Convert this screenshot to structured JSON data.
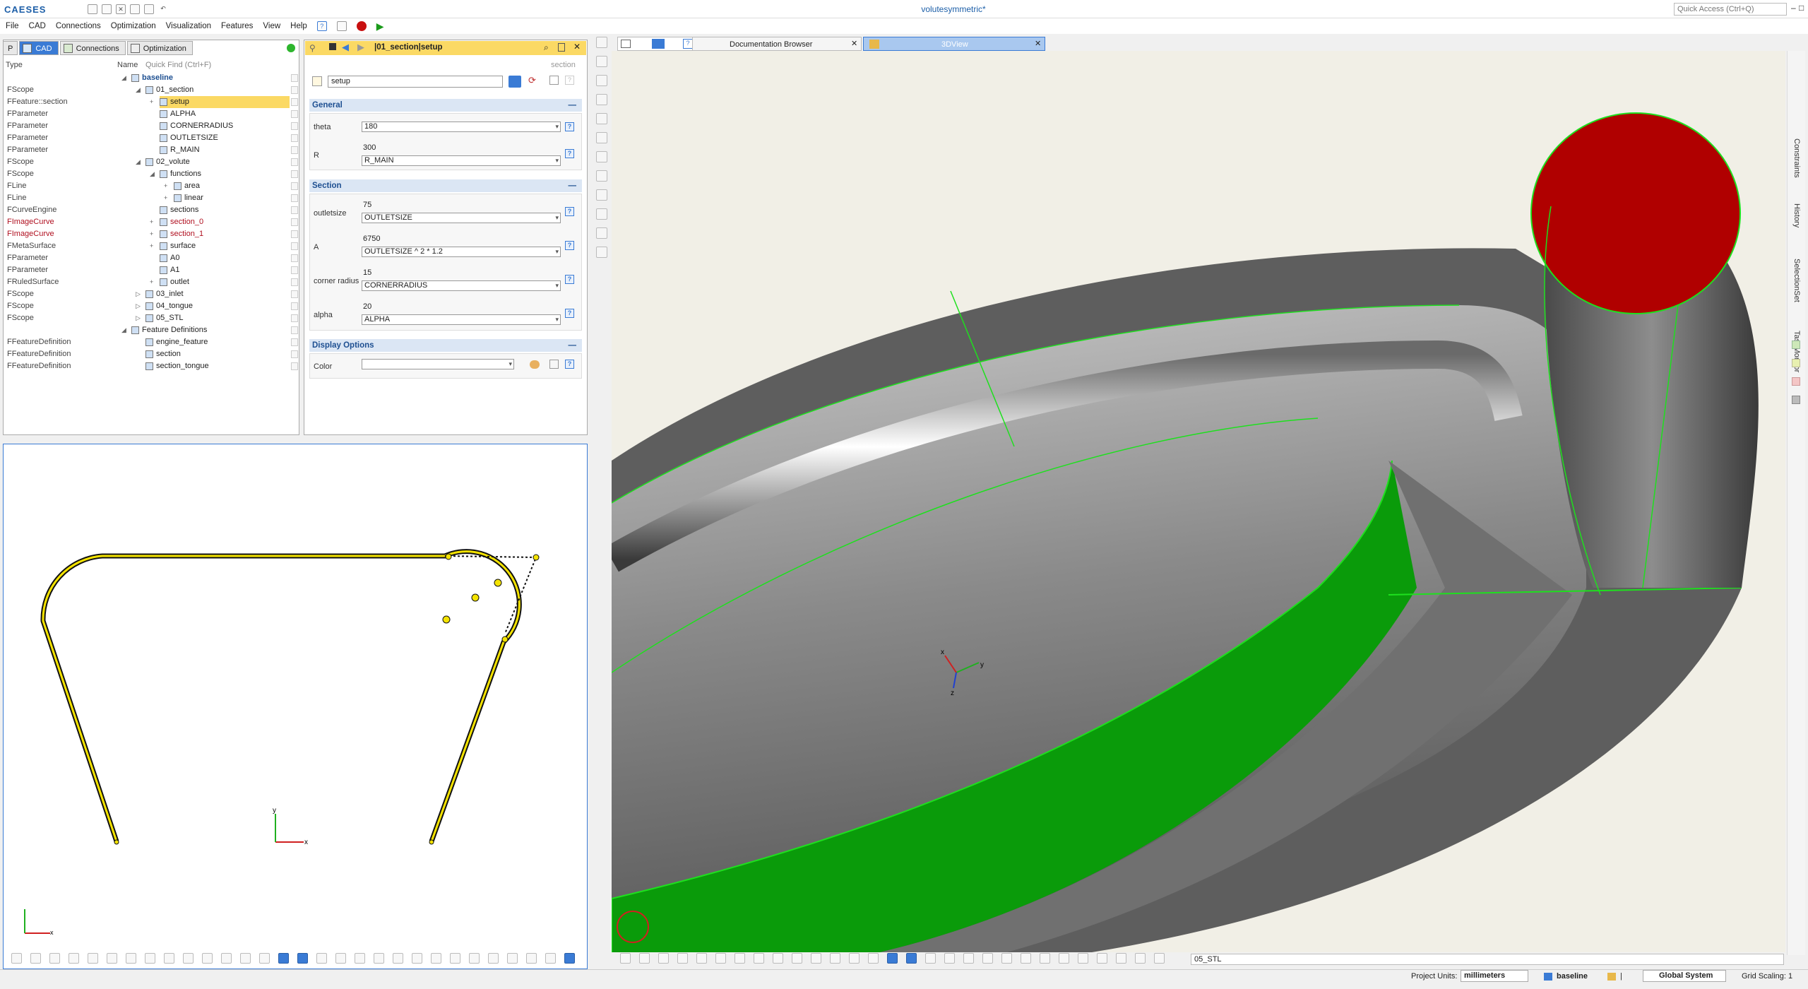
{
  "app": {
    "logo": "CAESES",
    "window_title": "volutesymmetric*",
    "quick_access_placeholder": "Quick Access (Ctrl+Q)",
    "window_controls": [
      "–",
      "□",
      "✕"
    ]
  },
  "menu": [
    "File",
    "CAD",
    "Connections",
    "Optimization",
    "Visualization",
    "Features",
    "View",
    "Help"
  ],
  "left_tabs": [
    {
      "label": "P",
      "active": false
    },
    {
      "label": "CAD",
      "active": true
    },
    {
      "label": "Connections",
      "active": false
    },
    {
      "label": "Optimization",
      "active": false
    }
  ],
  "tree": {
    "header_type": "Type",
    "header_name": "Name",
    "quick_find": "Quick Find (Ctrl+F)",
    "rows": [
      {
        "type": "",
        "name": "baseline",
        "level": 0,
        "exp": "◢",
        "bold": true,
        "red": false,
        "sel": false
      },
      {
        "type": "FScope",
        "name": "01_section",
        "level": 1,
        "exp": "◢",
        "red": false,
        "sel": false
      },
      {
        "type": "FFeature::section",
        "name": "setup",
        "level": 2,
        "exp": "+",
        "red": false,
        "sel": true
      },
      {
        "type": "FParameter",
        "name": "ALPHA",
        "level": 2,
        "exp": "",
        "red": false,
        "sel": false
      },
      {
        "type": "FParameter",
        "name": "CORNERRADIUS",
        "level": 2,
        "exp": "",
        "red": false,
        "sel": false
      },
      {
        "type": "FParameter",
        "name": "OUTLETSIZE",
        "level": 2,
        "exp": "",
        "red": false,
        "sel": false
      },
      {
        "type": "FParameter",
        "name": "R_MAIN",
        "level": 2,
        "exp": "",
        "red": false,
        "sel": false
      },
      {
        "type": "FScope",
        "name": "02_volute",
        "level": 1,
        "exp": "◢",
        "red": false,
        "sel": false
      },
      {
        "type": "FScope",
        "name": "functions",
        "level": 2,
        "exp": "◢",
        "red": false,
        "sel": false
      },
      {
        "type": "FLine",
        "name": "area",
        "level": 3,
        "exp": "+",
        "red": false,
        "sel": false
      },
      {
        "type": "FLine",
        "name": "linear",
        "level": 3,
        "exp": "+",
        "red": false,
        "sel": false
      },
      {
        "type": "FCurveEngine",
        "name": "sections",
        "level": 2,
        "exp": "",
        "red": false,
        "sel": false
      },
      {
        "type": "FImageCurve",
        "name": "section_0",
        "level": 2,
        "exp": "+",
        "red": true,
        "sel": false
      },
      {
        "type": "FImageCurve",
        "name": "section_1",
        "level": 2,
        "exp": "+",
        "red": true,
        "sel": false
      },
      {
        "type": "FMetaSurface",
        "name": "surface",
        "level": 2,
        "exp": "+",
        "red": false,
        "sel": false
      },
      {
        "type": "FParameter",
        "name": "A0",
        "level": 2,
        "exp": "",
        "red": false,
        "sel": false
      },
      {
        "type": "FParameter",
        "name": "A1",
        "level": 2,
        "exp": "",
        "red": false,
        "sel": false
      },
      {
        "type": "FRuledSurface",
        "name": "outlet",
        "level": 2,
        "exp": "+",
        "red": false,
        "sel": false
      },
      {
        "type": "FScope",
        "name": "03_inlet",
        "level": 1,
        "exp": "▷",
        "red": false,
        "sel": false
      },
      {
        "type": "FScope",
        "name": "04_tongue",
        "level": 1,
        "exp": "▷",
        "red": false,
        "sel": false
      },
      {
        "type": "FScope",
        "name": "05_STL",
        "level": 1,
        "exp": "▷",
        "red": false,
        "sel": false
      },
      {
        "type": "",
        "name": "Feature Definitions",
        "level": 0,
        "exp": "◢",
        "red": false,
        "sel": false
      },
      {
        "type": "FFeatureDefinition",
        "name": "engine_feature",
        "level": 1,
        "exp": "",
        "red": false,
        "sel": false
      },
      {
        "type": "FFeatureDefinition",
        "name": "section",
        "level": 1,
        "exp": "",
        "red": false,
        "sel": false
      },
      {
        "type": "FFeatureDefinition",
        "name": "section_tongue",
        "level": 1,
        "exp": "",
        "red": false,
        "sel": false
      }
    ]
  },
  "props": {
    "path": "|01_section|setup",
    "name_value": "setup",
    "type_hint": "section",
    "general_title": "General",
    "theta_label": "theta",
    "theta_value": "180",
    "r_label": "R",
    "r_value": "300",
    "r_expr": "R_MAIN",
    "section_title": "Section",
    "outletsize_label": "outletsize",
    "outletsize_value": "75",
    "outletsize_expr": "OUTLETSIZE",
    "a_label": "A",
    "a_value": "6750",
    "a_expr": "OUTLETSIZE ^ 2 * 1.2",
    "corner_label": "corner radius",
    "corner_value": "15",
    "corner_expr": "CORNERRADIUS",
    "alpha_label": "alpha",
    "alpha_value": "20",
    "alpha_expr": "ALPHA",
    "display_title": "Display Options",
    "color_label": "Color",
    "color_value": "",
    "collapse": "—",
    "help": "?"
  },
  "view_tabs": [
    {
      "label": "Documentation Browser",
      "active": false
    },
    {
      "label": "3DView",
      "active": true
    }
  ],
  "sidebar_right": [
    "Constraints",
    "History",
    "SelectionSet",
    "TaskMonitor"
  ],
  "viewer_search": "05_STL",
  "status": {
    "units_label": "Project Units:",
    "units_value": "millimeters",
    "scope": "baseline",
    "separator": "|",
    "system": "Global System",
    "grid_label": "Grid Scaling: 1"
  },
  "axes": {
    "x": "x",
    "y": "y",
    "z": "z"
  },
  "colors": {
    "accent": "#3a7bd5",
    "selection": "#fbd964",
    "surface_red": "#b00000",
    "surface_green": "#0a9b0a",
    "edge_green": "#1ee01e",
    "curve_yellow": "#f4e300"
  }
}
